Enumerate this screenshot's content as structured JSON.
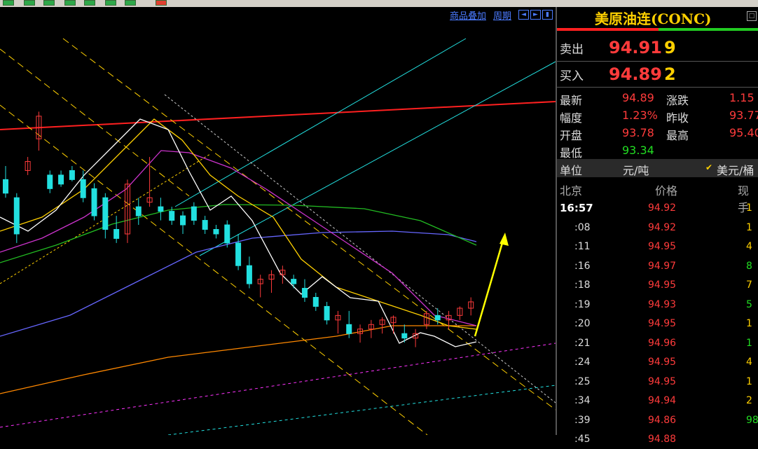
{
  "toolbar": {
    "buttons": [
      "",
      "",
      "",
      "",
      "",
      "",
      "",
      ""
    ]
  },
  "chart_header": {
    "overlay_label": "商品叠加",
    "period_label": "周期"
  },
  "quote": {
    "title": "美原油连(CONC)",
    "sell_label": "卖出",
    "sell_price": "94.91",
    "sell_qty": "9",
    "buy_label": "买入",
    "buy_price": "94.89",
    "buy_qty": "2",
    "fields": [
      {
        "label": "最新",
        "value": "94.89",
        "color": "#ff3b3b",
        "label2": "涨跌",
        "value2": "1.15",
        "color2": "#ff3b3b"
      },
      {
        "label": "幅度",
        "value": "1.23%",
        "color": "#ff3b3b",
        "label2": "昨收",
        "value2": "93.77",
        "color2": "#ff3b3b"
      },
      {
        "label": "开盘",
        "value": "93.78",
        "color": "#ff3b3b",
        "label2": "最高",
        "value2": "95.40",
        "color2": "#ff3b3b"
      },
      {
        "label": "最低",
        "value": "93.34",
        "color": "#22dd22"
      }
    ],
    "unit_label": "单位",
    "unit_value": "元/吨",
    "unit_alt": "美元/桶",
    "tick_headers": [
      "北京",
      "价格",
      "现手"
    ],
    "ticks": [
      {
        "time": "16:57",
        "price": "94.92",
        "vol": "1",
        "vcolor": "#ffd000"
      },
      {
        "time": ":08",
        "price": "94.92",
        "vol": "1",
        "vcolor": "#ffd000"
      },
      {
        "time": ":11",
        "price": "94.95",
        "vol": "4",
        "vcolor": "#ffd000"
      },
      {
        "time": ":16",
        "price": "94.97",
        "vol": "8",
        "vcolor": "#22dd22"
      },
      {
        "time": ":18",
        "price": "94.95",
        "vol": "7",
        "vcolor": "#ffd000"
      },
      {
        "time": ":19",
        "price": "94.93",
        "vol": "5",
        "vcolor": "#22dd22"
      },
      {
        "time": ":20",
        "price": "94.95",
        "vol": "1",
        "vcolor": "#ffd000"
      },
      {
        "time": ":21",
        "price": "94.96",
        "vol": "1",
        "vcolor": "#22dd22"
      },
      {
        "time": ":24",
        "price": "94.95",
        "vol": "4",
        "vcolor": "#ffd000"
      },
      {
        "time": ":25",
        "price": "94.95",
        "vol": "1",
        "vcolor": "#ffd000"
      },
      {
        "time": ":34",
        "price": "94.94",
        "vol": "2",
        "vcolor": "#ffd000"
      },
      {
        "time": ":39",
        "price": "94.86",
        "vol": "98",
        "vcolor": "#22dd22"
      },
      {
        "time": ":45",
        "price": "94.88",
        "vol": "",
        "vcolor": "#ffd000"
      }
    ]
  },
  "colors": {
    "up": "#ff3b3b",
    "down": "#22e0e0",
    "title": "#ffd000",
    "ma5": "#ffffff",
    "ma10": "#ffd000",
    "ma20": "#cc33cc",
    "ma40": "#22bb22",
    "ma60": "#6666ff",
    "ma120": "#ff8800",
    "channel": "#ffd000",
    "trend": "#22e0e0",
    "resistance": "#ff2020",
    "arrow": "#ffff00"
  },
  "chart_data": {
    "type": "candlestick",
    "candles": [
      {
        "o": 320,
        "h": 335,
        "l": 300,
        "c": 305
      },
      {
        "o": 300,
        "h": 305,
        "l": 250,
        "c": 260
      },
      {
        "o": 330,
        "h": 345,
        "l": 325,
        "c": 340
      },
      {
        "o": 365,
        "h": 395,
        "l": 352,
        "c": 390
      },
      {
        "o": 325,
        "h": 330,
        "l": 305,
        "c": 310
      },
      {
        "o": 325,
        "h": 330,
        "l": 312,
        "c": 315
      },
      {
        "o": 330,
        "h": 335,
        "l": 318,
        "c": 320
      },
      {
        "o": 320,
        "h": 330,
        "l": 295,
        "c": 300
      },
      {
        "o": 310,
        "h": 316,
        "l": 275,
        "c": 280
      },
      {
        "o": 300,
        "h": 305,
        "l": 255,
        "c": 265
      },
      {
        "o": 265,
        "h": 280,
        "l": 250,
        "c": 255
      },
      {
        "o": 260,
        "h": 320,
        "l": 250,
        "c": 315
      },
      {
        "o": 290,
        "h": 300,
        "l": 270,
        "c": 280
      },
      {
        "o": 295,
        "h": 345,
        "l": 290,
        "c": 300
      },
      {
        "o": 290,
        "h": 300,
        "l": 275,
        "c": 285
      },
      {
        "o": 285,
        "h": 290,
        "l": 270,
        "c": 275
      },
      {
        "o": 280,
        "h": 285,
        "l": 260,
        "c": 270
      },
      {
        "o": 290,
        "h": 295,
        "l": 270,
        "c": 275
      },
      {
        "o": 275,
        "h": 280,
        "l": 260,
        "c": 265
      },
      {
        "o": 265,
        "h": 270,
        "l": 255,
        "c": 260
      },
      {
        "o": 270,
        "h": 275,
        "l": 245,
        "c": 250
      },
      {
        "o": 250,
        "h": 260,
        "l": 220,
        "c": 225
      },
      {
        "o": 225,
        "h": 235,
        "l": 200,
        "c": 205
      },
      {
        "o": 205,
        "h": 215,
        "l": 190,
        "c": 210
      },
      {
        "o": 210,
        "h": 220,
        "l": 195,
        "c": 215
      },
      {
        "o": 215,
        "h": 225,
        "l": 205,
        "c": 220
      },
      {
        "o": 210,
        "h": 215,
        "l": 200,
        "c": 205
      },
      {
        "o": 200,
        "h": 210,
        "l": 185,
        "c": 190
      },
      {
        "o": 190,
        "h": 195,
        "l": 175,
        "c": 180
      },
      {
        "o": 180,
        "h": 185,
        "l": 160,
        "c": 165
      },
      {
        "o": 165,
        "h": 175,
        "l": 150,
        "c": 170
      },
      {
        "o": 160,
        "h": 175,
        "l": 145,
        "c": 150
      },
      {
        "o": 150,
        "h": 160,
        "l": 140,
        "c": 155
      },
      {
        "o": 155,
        "h": 165,
        "l": 145,
        "c": 160
      },
      {
        "o": 160,
        "h": 168,
        "l": 150,
        "c": 165
      },
      {
        "o": 162,
        "h": 170,
        "l": 150,
        "c": 168
      },
      {
        "o": 150,
        "h": 160,
        "l": 140,
        "c": 145
      },
      {
        "o": 145,
        "h": 155,
        "l": 135,
        "c": 150
      },
      {
        "o": 160,
        "h": 175,
        "l": 155,
        "c": 172
      },
      {
        "o": 170,
        "h": 178,
        "l": 160,
        "c": 165
      },
      {
        "o": 165,
        "h": 175,
        "l": 155,
        "c": 170
      },
      {
        "o": 170,
        "h": 180,
        "l": 165,
        "c": 178
      },
      {
        "o": 178,
        "h": 190,
        "l": 170,
        "c": 185
      }
    ]
  }
}
